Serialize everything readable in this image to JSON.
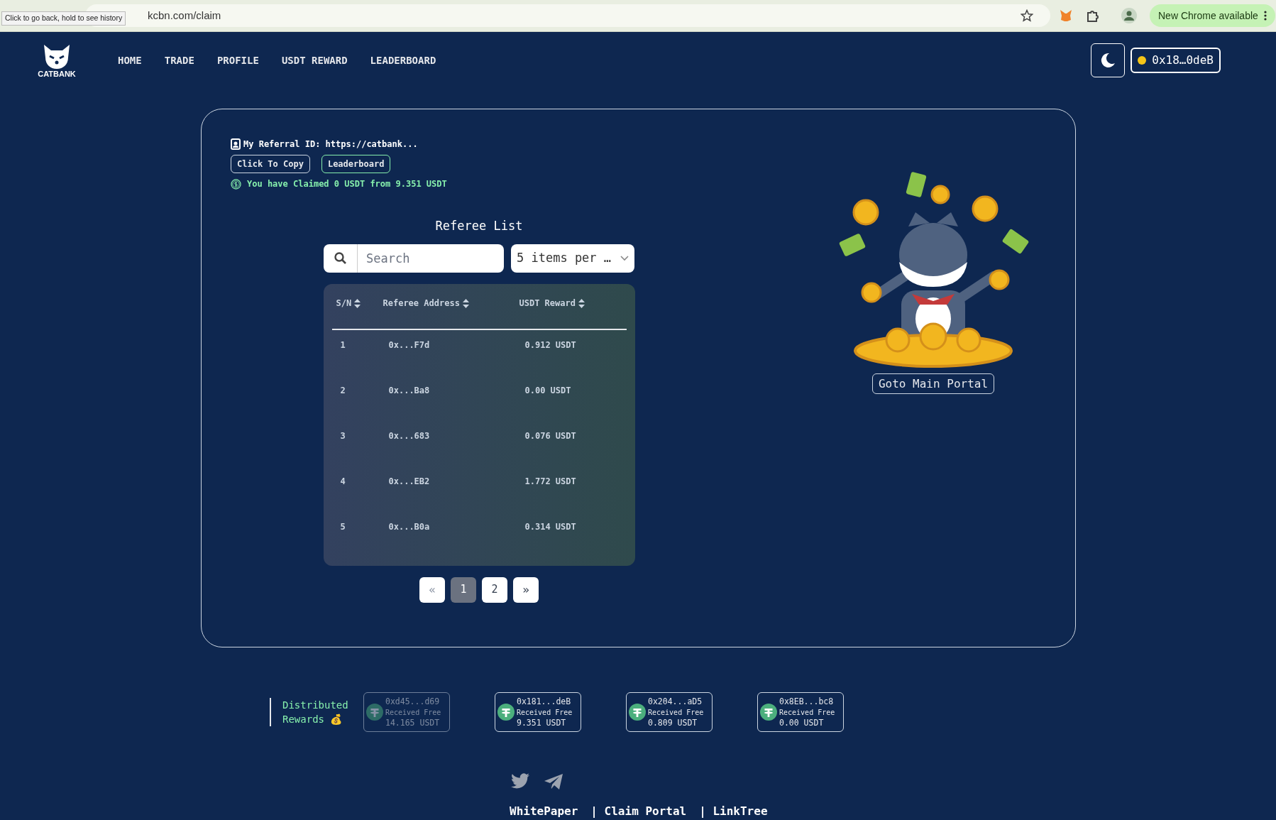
{
  "browser": {
    "url": "kcbn.com/claim",
    "tooltip": "Click to go back, hold to see history",
    "update_button": "New Chrome available"
  },
  "nav": {
    "logo_text": "CATBANK",
    "items": [
      {
        "label": "HOME"
      },
      {
        "label": "TRADE"
      },
      {
        "label": "PROFILE"
      },
      {
        "label": "USDT REWARD"
      },
      {
        "label": "LEADERBOARD"
      }
    ],
    "wallet": "0x18…0deB"
  },
  "referral": {
    "id_text": "My Referral ID: https://catbank...",
    "copy_button": "Click To Copy",
    "leaderboard_button": "Leaderboard",
    "claimed_text": "You have Claimed 0 USDT from 9.351 USDT"
  },
  "referee_list": {
    "title": "Referee List",
    "search": {
      "placeholder": "Search"
    },
    "per_page": "5 items per …",
    "columns": [
      "S/N",
      "Referee Address",
      "USDT Reward"
    ],
    "rows": [
      {
        "sn": "1",
        "address": "0x...F7d",
        "reward": "0.912 USDT"
      },
      {
        "sn": "2",
        "address": "0x...Ba8",
        "reward": "0.00 USDT"
      },
      {
        "sn": "3",
        "address": "0x...683",
        "reward": "0.076 USDT"
      },
      {
        "sn": "4",
        "address": "0x...EB2",
        "reward": "1.772 USDT"
      },
      {
        "sn": "5",
        "address": "0x...B0a",
        "reward": "0.314 USDT"
      }
    ],
    "pagination": {
      "prev": {
        "label": "«",
        "disabled": true
      },
      "pages": [
        {
          "label": "1",
          "selected": true
        },
        {
          "label": "2",
          "selected": false
        }
      ],
      "next": {
        "label": "»",
        "disabled": false
      }
    }
  },
  "portal_button": "Goto Main Portal",
  "distributed": {
    "title": "Distributed Rewards",
    "emoji": "💰",
    "cards": [
      {
        "address": "0xd45...d69",
        "label": "Received Free",
        "amount": "14.165 USDT",
        "faded": true
      },
      {
        "address": "0x181...deB",
        "label": "Received Free",
        "amount": "9.351 USDT",
        "faded": false
      },
      {
        "address": "0x204...aD5",
        "label": "Received Free",
        "amount": "0.809 USDT",
        "faded": false
      },
      {
        "address": "0x8EB...bc8",
        "label": "Received Free",
        "amount": "0.00 USDT",
        "faded": false
      }
    ]
  },
  "footer": {
    "links": [
      "WhitePaper",
      "| Claim Portal",
      "| LinkTree"
    ]
  }
}
